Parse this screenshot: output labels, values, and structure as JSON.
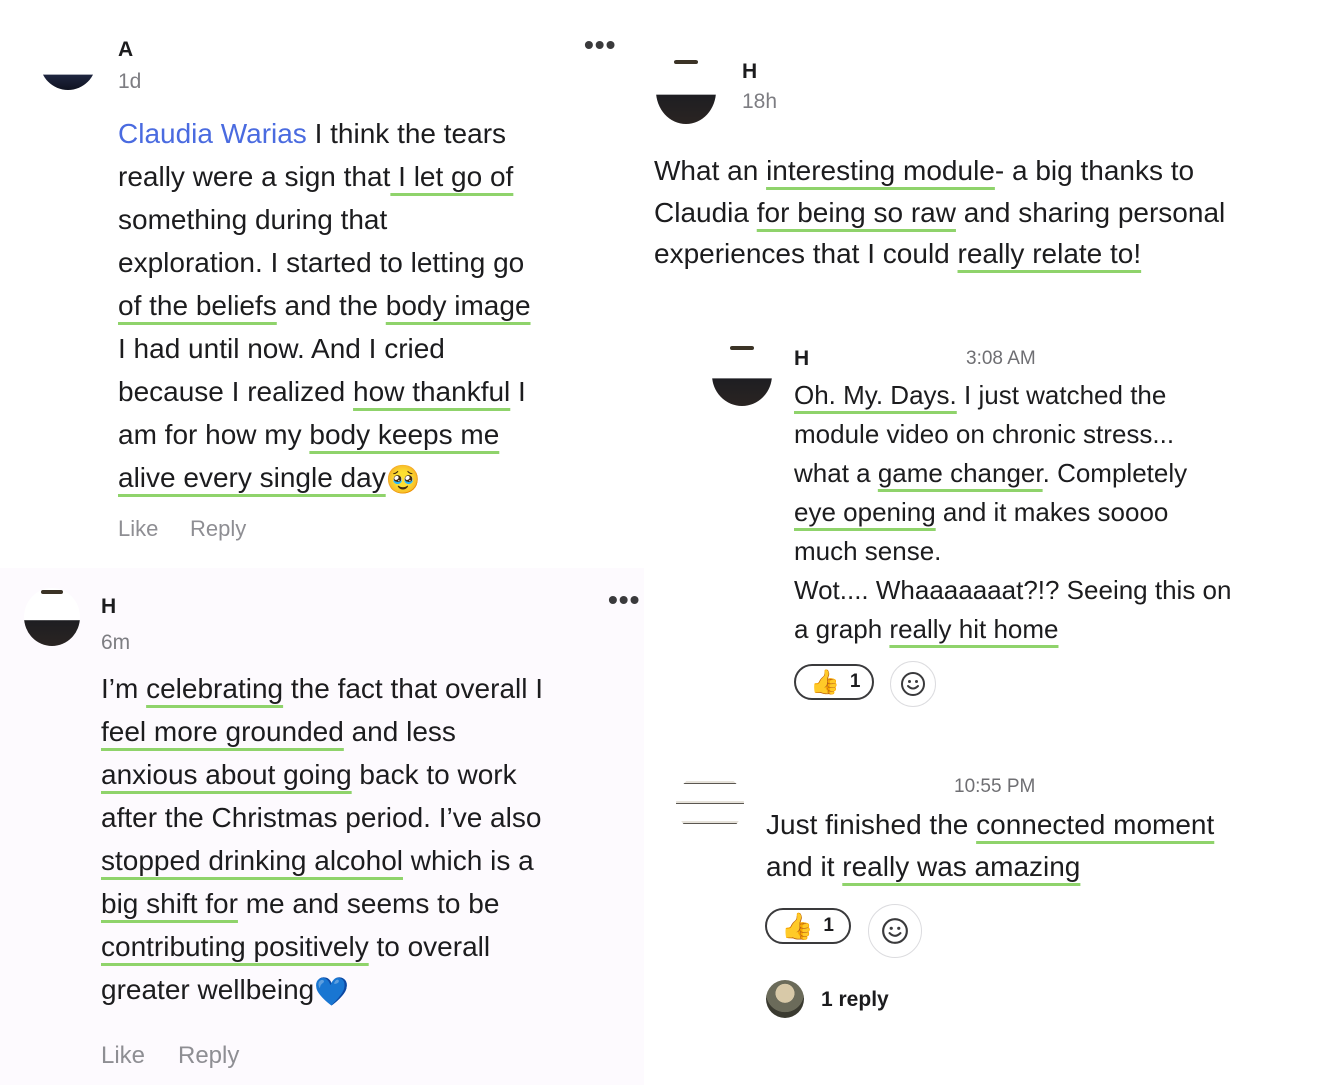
{
  "comment_a": {
    "author": "A",
    "time": "1d",
    "mention": "Claudia Warias",
    "lines": [
      [
        {
          "t": " I think the tears",
          "u": false
        }
      ],
      [
        {
          "t": "really were a sign that",
          "u": false
        },
        {
          "t": " I let go of",
          "u": true
        }
      ],
      [
        {
          "t": "something during that",
          "u": false
        }
      ],
      [
        {
          "t": "exploration. I started to letting go",
          "u": false
        }
      ],
      [
        {
          "t": "of the beliefs",
          "u": true
        },
        {
          "t": " and the ",
          "u": false
        },
        {
          "t": "body image",
          "u": true
        }
      ],
      [
        {
          "t": "I had until now. And I cried",
          "u": false
        }
      ],
      [
        {
          "t": "because I realized ",
          "u": false
        },
        {
          "t": "how thankful",
          "u": true
        },
        {
          "t": " I",
          "u": false
        }
      ],
      [
        {
          "t": "am for how my ",
          "u": false
        },
        {
          "t": "body keeps me",
          "u": true
        }
      ],
      [
        {
          "t": "alive every single day",
          "u": true
        }
      ]
    ],
    "emoji": "🥹",
    "like": "Like",
    "reply": "Reply"
  },
  "comment_h1": {
    "author": "H",
    "time": "18h",
    "lines": [
      [
        {
          "t": "What an ",
          "u": false
        },
        {
          "t": "interesting module",
          "u": true
        },
        {
          "t": "- a big thanks to",
          "u": false
        }
      ],
      [
        {
          "t": "Claudia ",
          "u": false
        },
        {
          "t": "for being so raw",
          "u": true
        },
        {
          "t": " and sharing personal",
          "u": false
        }
      ],
      [
        {
          "t": "experiences that I could ",
          "u": false
        },
        {
          "t": "really relate to!",
          "u": true
        }
      ]
    ]
  },
  "comment_h2": {
    "author": "H",
    "time": "3:08 AM",
    "lines": [
      [
        {
          "t": "Oh. My. Days.",
          "u": true
        },
        {
          "t": " I just watched the",
          "u": false
        }
      ],
      [
        {
          "t": "module video on chronic stress...",
          "u": false
        }
      ],
      [
        {
          "t": "what a ",
          "u": false
        },
        {
          "t": "game changer",
          "u": true
        },
        {
          "t": ". Completely",
          "u": false
        }
      ],
      [
        {
          "t": "eye opening",
          "u": true
        },
        {
          "t": " and it makes soooo",
          "u": false
        }
      ],
      [
        {
          "t": "much sense.",
          "u": false
        }
      ],
      [
        {
          "t": "Wot.... Whaaaaaaat?!? Seeing this on",
          "u": false
        }
      ],
      [
        {
          "t": "a graph ",
          "u": false
        },
        {
          "t": "really hit home",
          "u": true
        }
      ]
    ],
    "reaction_emoji": "👍",
    "reaction_count": "1"
  },
  "comment_h3": {
    "author": "H",
    "time": "6m",
    "lines": [
      [
        {
          "t": "I’m ",
          "u": false
        },
        {
          "t": "celebrating",
          "u": true
        },
        {
          "t": " the fact that overall I",
          "u": false
        }
      ],
      [
        {
          "t": "feel more grounded",
          "u": true
        },
        {
          "t": " and less",
          "u": false
        }
      ],
      [
        {
          "t": "anxious about going",
          "u": true
        },
        {
          "t": " back to work",
          "u": false
        }
      ],
      [
        {
          "t": "after the Christmas period. I’ve also",
          "u": false
        }
      ],
      [
        {
          "t": "stopped drinking alcohol",
          "u": true
        },
        {
          "t": " which is a",
          "u": false
        }
      ],
      [
        {
          "t": "big shift for",
          "u": true
        },
        {
          "t": " me and seems to be",
          "u": false
        }
      ],
      [
        {
          "t": "contributing positively",
          "u": true
        },
        {
          "t": " to overall",
          "u": false
        }
      ],
      [
        {
          "t": "greater wellbeing",
          "u": false
        }
      ]
    ],
    "emoji": "💙",
    "like": "Like",
    "reply": "Reply"
  },
  "comment_4": {
    "time": "10:55 PM",
    "lines": [
      [
        {
          "t": "Just finished the ",
          "u": false
        },
        {
          "t": "connected moment",
          "u": true
        }
      ],
      [
        {
          "t": "and it ",
          "u": false
        },
        {
          "t": "really was amazing",
          "u": true
        }
      ]
    ],
    "reaction_emoji": "👍",
    "reaction_count": "1",
    "reply_count_label": "1 reply"
  },
  "icons": {
    "more": "more-horizontal-icon",
    "add_reaction": "smiley-icon"
  },
  "colors": {
    "mention": "#4a6be0",
    "underline": "#8fd36b",
    "meta": "#7d7d82",
    "panel": "#fdfafe"
  }
}
